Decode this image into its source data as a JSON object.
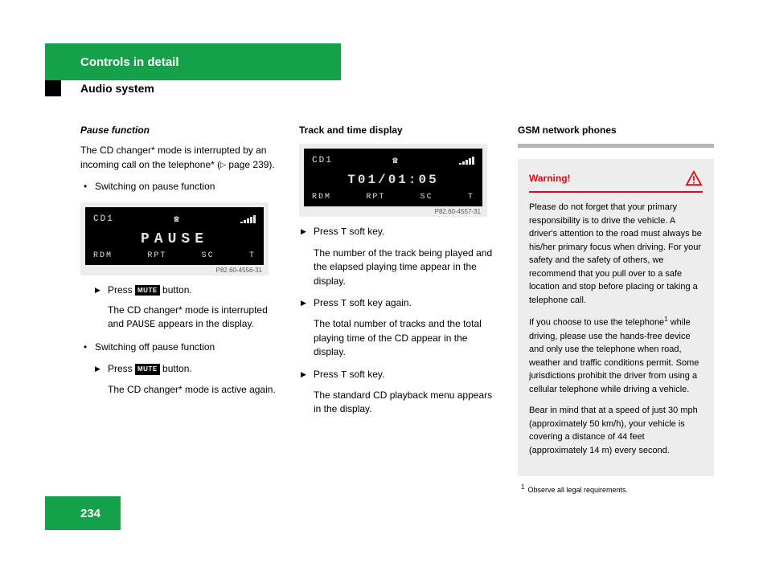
{
  "header": {
    "chapter": "Controls in detail",
    "section": "Audio system"
  },
  "page_number": "234",
  "col1": {
    "h": "Pause function",
    "intro_a": "The CD changer* mode is interrupted by an incoming call on the telephone* (",
    "pageref": " page 239).",
    "bul1": "Switching on pause function",
    "display": {
      "cd": "CD1",
      "mid": "PAUSE",
      "softkeys": {
        "a": "RDM",
        "b": "RPT",
        "c": "SC",
        "d": "T"
      },
      "caption": "P82.60-4556-31"
    },
    "a1_a": "Press ",
    "mute": "MUTE",
    "a1_b": " button.",
    "a1_desc_a": "The CD changer* mode is interrupted and ",
    "pauseword": "PAUSE",
    "a1_desc_b": " appears in the display.",
    "bul2": "Switching off pause function",
    "a2_a": "Press ",
    "a2_b": " button.",
    "a2_desc": "The CD changer* mode is active again."
  },
  "col2": {
    "h": "Track and time display",
    "display": {
      "cd": "CD1",
      "mid": "T01/01:05",
      "softkeys": {
        "a": "RDM",
        "b": "RPT",
        "c": "SC",
        "d": "T"
      },
      "caption": "P82.60-4557-31"
    },
    "s1_a": "Press ",
    "softT": "T",
    "s1_b": " soft key.",
    "s1_desc": "The number of the track being played and the elapsed playing time appear in the display.",
    "s2_a": "Press ",
    "s2_b": " soft key again.",
    "s2_desc": "The total number of tracks and the total playing time of the CD appear in the display.",
    "s3_a": "Press ",
    "s3_b": " soft key.",
    "s3_desc": "The standard CD playback menu appears in the display."
  },
  "col3": {
    "h": "GSM network phones",
    "warn_title": "Warning!",
    "p1": "Please do not forget that your primary responsibility is to drive the vehicle. A driver's attention to the road must always be his/her primary focus when driving. For your safety and the safety of others, we recommend that you pull over to a safe location and stop before placing or taking a telephone call.",
    "p2_a": "If you choose to use the telephone",
    "p2_b": " while driving, please use the hands-free device and only use the telephone when road, weather and traffic conditions permit. Some jurisdictions prohibit the driver from using a cellular telephone while driving a vehicle.",
    "p3": "Bear in mind that at a speed of just 30 mph (approximately 50 km/h), your vehicle is covering a distance of 44 feet (approximately 14 m) every second.",
    "fn_mark": "1",
    "fn": "Observe all legal requirements."
  }
}
